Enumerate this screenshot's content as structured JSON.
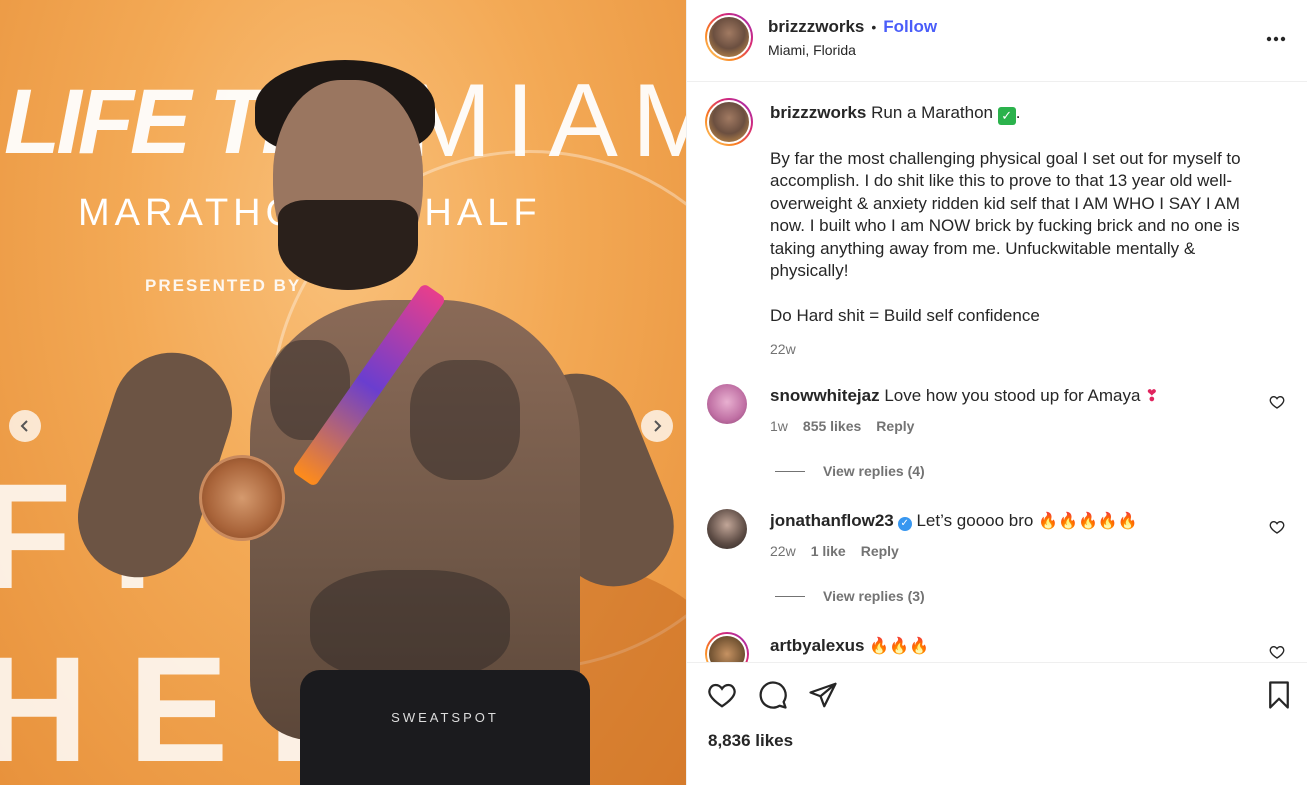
{
  "photo": {
    "banner_top_left": "LIFE TIM",
    "banner_top_right": "MIAM",
    "banner_sub": "MARATHO    AND HALF",
    "banner_presented": "PRESENTED BY",
    "banner_bottom": "FI    HER",
    "shorts_text": "SWEATSPOT",
    "colors": {
      "background": "#f3a955"
    }
  },
  "header": {
    "username": "brizzzworks",
    "separator": "•",
    "follow_label": "Follow",
    "location": "Miami, Florida",
    "more_icon": "more-horizontal-icon"
  },
  "caption": {
    "username": "brizzzworks",
    "title": "Run a Marathon",
    "title_emoji": "✓",
    "title_end": ".",
    "paragraph1": "By far the most challenging physical goal I set out for myself to accomplish. I do shit like this to prove to that 13 year old well-overweight & anxiety ridden kid self that I AM WHO I SAY I AM now. I built who I am NOW brick by fucking brick and no one is taking anything away from me. Unfuckwitable mentally & physically!",
    "paragraph2": "Do Hard shit = Build self confidence",
    "time": "22w"
  },
  "comments": [
    {
      "username": "snowwhitejaz",
      "text": "Love how you stood up for Amaya",
      "emoji": "❣",
      "time": "1w",
      "likes": "855 likes",
      "reply_label": "Reply",
      "view_replies": "View replies (4)"
    },
    {
      "username": "jonathanflow23",
      "verified": "✓",
      "text": "Let’s goooo bro",
      "emoji": "🔥🔥🔥🔥🔥",
      "time": "22w",
      "likes": "1 like",
      "reply_label": "Reply",
      "view_replies": "View replies (3)"
    },
    {
      "username": "artbyalexus",
      "text": "",
      "emoji": "🔥🔥🔥"
    }
  ],
  "actions": {
    "likes": "8,836 likes",
    "icons": [
      "heart-icon",
      "comment-icon",
      "share-icon",
      "bookmark-icon"
    ]
  },
  "colors": {
    "accent": "#4a5df9",
    "muted": "#737373",
    "text": "#262626"
  }
}
